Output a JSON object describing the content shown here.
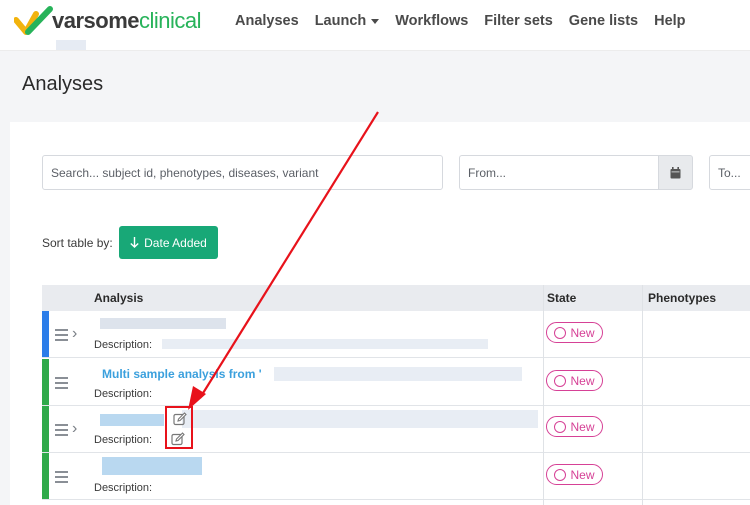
{
  "nav": {
    "logo_part1": "varsome",
    "logo_part2": "clinical",
    "items": [
      "Analyses",
      "Launch",
      "Workflows",
      "Filter sets",
      "Gene lists",
      "Help"
    ]
  },
  "page": {
    "title": "Analyses"
  },
  "filters": {
    "search_placeholder": "Search... subject id, phenotypes, diseases, variant",
    "from_placeholder": "From...",
    "to_placeholder": "To..."
  },
  "sort": {
    "label": "Sort table by:",
    "button": "Date Added"
  },
  "table": {
    "headers": [
      "Analysis",
      "State",
      "Phenotypes"
    ],
    "rows": [
      {
        "title": "",
        "description_label": "Description:",
        "state": "New",
        "stripe_color": "#2b7de9"
      },
      {
        "title": "Multi sample analysis from '",
        "description_label": "Description:",
        "state": "New",
        "stripe_color": "#2faa4a"
      },
      {
        "title": "",
        "description_label": "Description:",
        "state": "New",
        "stripe_color": "#2faa4a"
      },
      {
        "title": "",
        "description_label": "Description:",
        "state": "New",
        "stripe_color": "#2faa4a"
      }
    ]
  },
  "colors": {
    "accent_green": "#18a877",
    "state_pink": "#d64196",
    "annotation_red": "#e8121b"
  }
}
